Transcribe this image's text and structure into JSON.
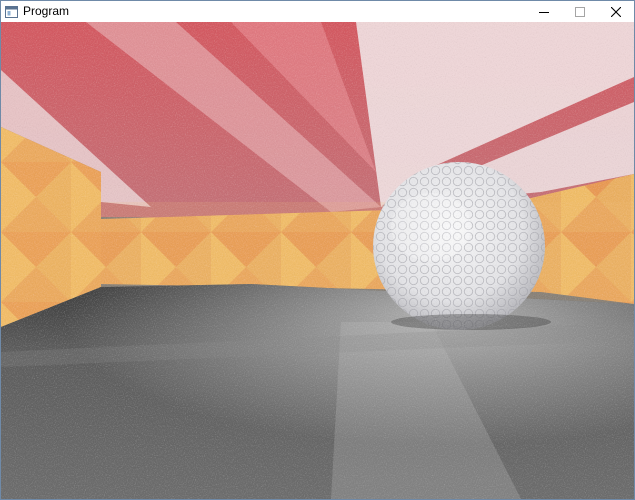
{
  "window": {
    "title": "Program",
    "icon": "application-icon",
    "controls": {
      "minimize_icon": "minimize-icon",
      "maximize_icon": "maximize-icon",
      "close_icon": "close-icon"
    }
  },
  "scene": {
    "description_icon": "render-viewport",
    "colors": {
      "ceiling_red": "#d9545d",
      "ceiling_light": "#efe4e6",
      "wall_orange": "#e8a25a",
      "wall_yellow": "#efbe63",
      "floor": "#5f5f5f",
      "sphere": "#e8e8ea",
      "titlebar_border": "#6f8aa8"
    }
  }
}
